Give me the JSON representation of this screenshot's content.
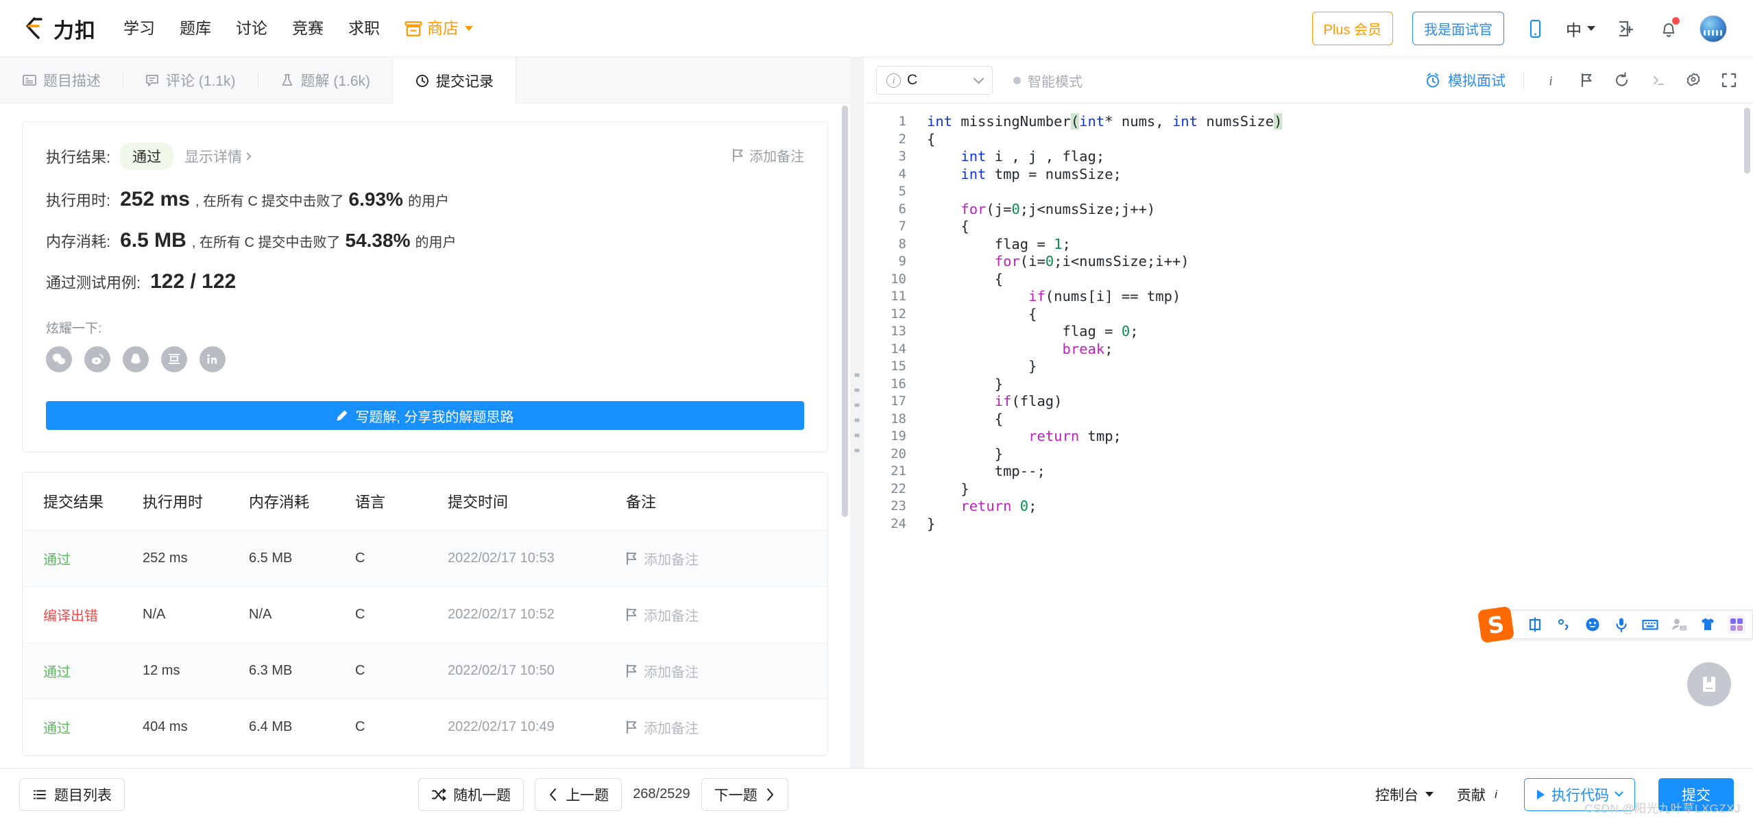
{
  "nav": {
    "brand": "力扣",
    "links": [
      {
        "label": "学习"
      },
      {
        "label": "题库"
      },
      {
        "label": "讨论"
      },
      {
        "label": "竞赛"
      },
      {
        "label": "求职"
      }
    ],
    "shop": "商店",
    "plus_label": "Plus 会员",
    "interviewer_label": "我是面试官",
    "lang": "中",
    "icons": [
      "mobile-icon",
      "language-icon",
      "terminal-add-icon",
      "bell-icon",
      "avatar"
    ]
  },
  "tabs": [
    {
      "label": "题目描述",
      "icon": "description-icon",
      "active": false
    },
    {
      "label": "评论 (1.1k)",
      "icon": "comment-icon",
      "active": false
    },
    {
      "label": "题解 (1.6k)",
      "icon": "flask-icon",
      "active": false
    },
    {
      "label": "提交记录",
      "icon": "clock-icon",
      "active": true
    }
  ],
  "result": {
    "result_label": "执行结果:",
    "status": "通过",
    "detail_link": "显示详情",
    "note_label": "添加备注",
    "runtime_label": "执行用时:",
    "runtime_value": "252 ms",
    "runtime_mid": ", 在所有 C 提交中击败了",
    "runtime_pct": "6.93%",
    "runtime_tail": "的用户",
    "memory_label": "内存消耗:",
    "memory_value": "6.5 MB",
    "memory_mid": ", 在所有 C 提交中击败了",
    "memory_pct": "54.38%",
    "memory_tail": "的用户",
    "testcase_label": "通过测试用例:",
    "testcase_value": "122 / 122",
    "show_off_label": "炫耀一下:",
    "share": [
      {
        "name": "wechat-icon"
      },
      {
        "name": "weibo-icon"
      },
      {
        "name": "qq-icon"
      },
      {
        "name": "douban-icon"
      },
      {
        "name": "linkedin-icon"
      }
    ],
    "write_solution_label": "写题解, 分享我的解题思路"
  },
  "table": {
    "headers": [
      "提交结果",
      "执行用时",
      "内存消耗",
      "语言",
      "提交时间",
      "备注"
    ],
    "note_action": "添加备注",
    "rows": [
      {
        "status": "通过",
        "status_type": "pass",
        "runtime": "252 ms",
        "memory": "6.5 MB",
        "language": "C",
        "time": "2022/02/17 10:53"
      },
      {
        "status": "编译出错",
        "status_type": "error",
        "runtime": "N/A",
        "memory": "N/A",
        "language": "C",
        "time": "2022/02/17 10:52"
      },
      {
        "status": "通过",
        "status_type": "pass",
        "runtime": "12 ms",
        "memory": "6.3 MB",
        "language": "C",
        "time": "2022/02/17 10:50"
      },
      {
        "status": "通过",
        "status_type": "pass",
        "runtime": "404 ms",
        "memory": "6.4 MB",
        "language": "C",
        "time": "2022/02/17 10:49"
      }
    ]
  },
  "editor": {
    "language": "C",
    "smart_mode": "智能模式",
    "mock_interview": "模拟面试",
    "toolbar_icons": [
      "info-icon",
      "flag-icon",
      "reset-icon",
      "console-icon",
      "settings-icon",
      "fullscreen-icon"
    ],
    "code_lines": [
      "int missingNumber(int* nums, int numsSize)",
      "{",
      "    int i , j , flag;",
      "    int tmp = numsSize;",
      "",
      "    for(j=0;j<numsSize;j++)",
      "    {",
      "        flag = 1;",
      "        for(i=0;i<numsSize;i++)",
      "        {",
      "            if(nums[i] == tmp)",
      "            {",
      "                flag = 0;",
      "                break;",
      "            }",
      "        }",
      "        if(flag)",
      "        {",
      "            return tmp;",
      "        }",
      "        tmp--;",
      "    }",
      "    return 0;",
      "}"
    ]
  },
  "ime": {
    "logo": "S",
    "items": [
      "中",
      "°,",
      "emoji-icon",
      "mic-icon",
      "keyboard-icon",
      "user-icon",
      "skin-icon",
      "apps-icon"
    ]
  },
  "bottom": {
    "problem_list": "题目列表",
    "random": "随机一题",
    "prev": "上一题",
    "counter": "268/2529",
    "next": "下一题",
    "console": "控制台",
    "contribute": "贡献",
    "run_code": "执行代码",
    "submit": "提交"
  },
  "watermark": "CSDN @阳光九叶草LXGZXJ",
  "colors": {
    "brand_orange": "#f90",
    "primary_blue": "#1890ff",
    "link_blue": "#2d8cf0",
    "pass_green": "#5cb85c",
    "error_red": "#f04c4c"
  }
}
